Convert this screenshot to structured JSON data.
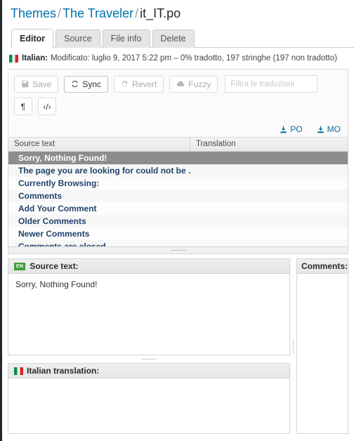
{
  "breadcrumb": {
    "items": [
      {
        "label": "Themes",
        "link": true
      },
      {
        "label": "The Traveler",
        "link": true
      },
      {
        "label": "it_IT.po",
        "link": false
      }
    ],
    "separator": "/"
  },
  "tabs": [
    {
      "label": "Editor",
      "active": true
    },
    {
      "label": "Source",
      "active": false
    },
    {
      "label": "File info",
      "active": false
    },
    {
      "label": "Delete",
      "active": false
    }
  ],
  "status": {
    "flag_icon": "italian-flag-icon",
    "language": "Italian:",
    "details": "Modificato: luglio 9, 2017 5:22 pm – 0% tradotto, 197 stringhe (197 non tradotto)"
  },
  "toolbar": {
    "buttons": [
      {
        "label": "Save",
        "icon": "floppy-disk-icon",
        "enabled": false
      },
      {
        "label": "Sync",
        "icon": "sync-icon",
        "enabled": true
      },
      {
        "label": "Revert",
        "icon": "revert-icon",
        "enabled": false
      },
      {
        "label": "Fuzzy",
        "icon": "cloud-icon",
        "enabled": false
      }
    ],
    "filter": {
      "value": "",
      "placeholder": "Filtra le traduzioni"
    },
    "toggles": [
      {
        "label": "¶",
        "name": "pilcrow-toggle"
      },
      {
        "label": "‹/›",
        "name": "code-toggle"
      }
    ],
    "downloads": [
      {
        "label": "PO",
        "icon": "download-icon"
      },
      {
        "label": "MO",
        "icon": "download-icon"
      }
    ]
  },
  "table": {
    "columns": [
      "Source text",
      "Translation"
    ],
    "rows": [
      {
        "source": "Sorry, Nothing Found!",
        "translation": "",
        "selected": true
      },
      {
        "source": "The page you are looking for could not be …",
        "translation": "",
        "selected": false
      },
      {
        "source": "Currently Browsing:",
        "translation": "",
        "selected": false
      },
      {
        "source": "Comments",
        "translation": "",
        "selected": false
      },
      {
        "source": "Add Your Comment",
        "translation": "",
        "selected": false
      },
      {
        "source": "Older Comments",
        "translation": "",
        "selected": false
      },
      {
        "source": "Newer Comments",
        "translation": "",
        "selected": false
      },
      {
        "source": "Comments are closed",
        "translation": "",
        "selected": false
      }
    ]
  },
  "editor": {
    "source": {
      "badge": "EN",
      "title": "Source text:",
      "value": "Sorry, Nothing Found!"
    },
    "translation": {
      "flag_icon": "italian-flag-icon",
      "title": "Italian translation:",
      "value": ""
    },
    "comments": {
      "title": "Comments:",
      "value": ""
    }
  },
  "colors": {
    "link": "#0073aa",
    "row_text": "#20436b",
    "selected_row_bg": "#8d8d8d",
    "download_link": "#0b6a9e",
    "badge_green": "#3d9e3d",
    "flag_green": "#059142",
    "flag_red": "#d9262c"
  }
}
